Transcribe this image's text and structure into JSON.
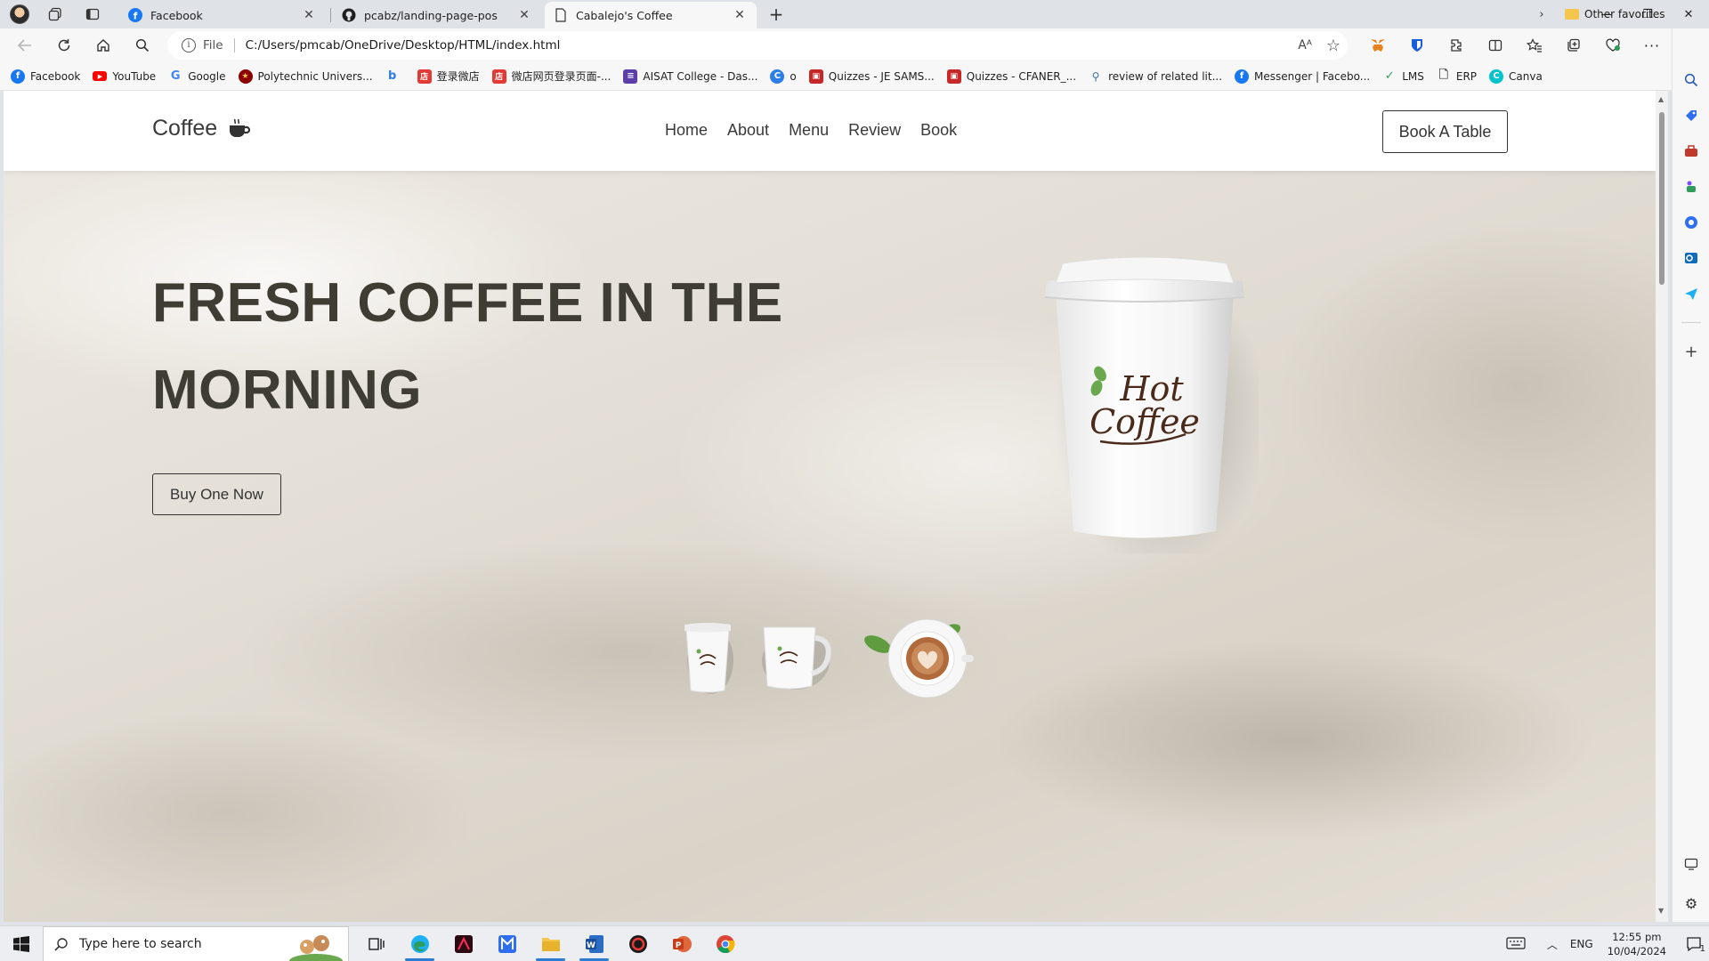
{
  "browser": {
    "tabs": [
      {
        "title": "Facebook",
        "icon": "facebook-icon",
        "active": false
      },
      {
        "title": "pcabz/landing-page-pos",
        "icon": "github-icon",
        "active": false
      },
      {
        "title": "Cabalejo's Coffee",
        "icon": "page-icon",
        "active": true
      }
    ],
    "address": {
      "scheme": "File",
      "url": "C:/Users/pmcab/OneDrive/Desktop/HTML/index.html"
    },
    "favorites": [
      {
        "label": "Facebook",
        "icon": "facebook-icon",
        "color": "#1877f2"
      },
      {
        "label": "YouTube",
        "icon": "youtube-icon",
        "color": "#ff0000"
      },
      {
        "label": "Google",
        "icon": "google-icon",
        "color": "#4285f4"
      },
      {
        "label": "Polytechnic Univers...",
        "icon": "pup-icon",
        "color": "#8b0000"
      },
      {
        "label": "",
        "icon": "bing-icon",
        "color": "#2b7de9"
      },
      {
        "label": "登录微店",
        "icon": "weidian-icon",
        "color": "#e53935"
      },
      {
        "label": "微店网页登录页面-...",
        "icon": "weidian-icon",
        "color": "#e53935"
      },
      {
        "label": "AISAT College - Das...",
        "icon": "aisat-icon",
        "color": "#5b3ea8"
      },
      {
        "label": "o",
        "icon": "c-icon",
        "color": "#2b7de9"
      },
      {
        "label": "Quizzes - JE SAMS...",
        "icon": "quiz-icon",
        "color": "#c62828"
      },
      {
        "label": "Quizzes - CFANER_...",
        "icon": "quiz-icon",
        "color": "#c62828"
      },
      {
        "label": "review of related lit...",
        "icon": "search-icon",
        "color": "#3b6ea5"
      },
      {
        "label": "Messenger | Facebo...",
        "icon": "facebook-icon",
        "color": "#1877f2"
      },
      {
        "label": "LMS",
        "icon": "lms-icon",
        "color": "#2e9d5a"
      },
      {
        "label": "ERP",
        "icon": "document-icon",
        "color": "#555555"
      },
      {
        "label": "Canva",
        "icon": "canva-icon",
        "color": "#00c4cc"
      }
    ],
    "other_favorites": "Other favorites"
  },
  "site": {
    "logo_text": "Coffee",
    "nav": [
      "Home",
      "About",
      "Menu",
      "Review",
      "Book"
    ],
    "book_button": "Book A Table",
    "hero_title_line1": "FRESH COFFEE IN THE",
    "hero_title_line2": "MORNING",
    "buy_button": "Buy One Now",
    "cup_brand_line1": "Hot",
    "cup_brand_line2": "Coffee"
  },
  "taskbar": {
    "search_placeholder": "Type here to search",
    "language": "ENG",
    "time": "12:55 pm",
    "date": "10/04/2024",
    "notification_count": "1"
  },
  "colors": {
    "hero_text": "#3f3d33",
    "accent_green": "#6aa84f",
    "brand_brown": "#4a2a1a"
  }
}
